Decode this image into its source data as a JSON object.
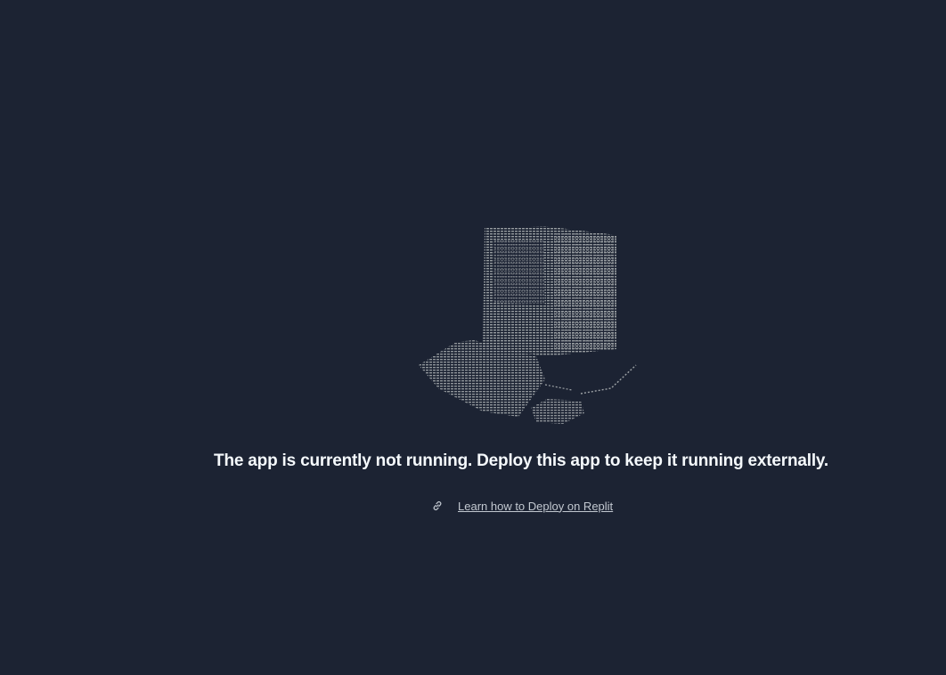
{
  "illustration": {
    "icon": "ascii-computer-illustration",
    "color": "#9da2a6"
  },
  "message": {
    "headline": "The app is currently not running. Deploy this app to keep it running externally."
  },
  "help_link": {
    "icon": "link-icon",
    "label": "Learn how to Deploy on Replit"
  },
  "colors": {
    "background": "#1c2333",
    "headline": "#f5f9fc",
    "link": "#c2c8d0"
  }
}
